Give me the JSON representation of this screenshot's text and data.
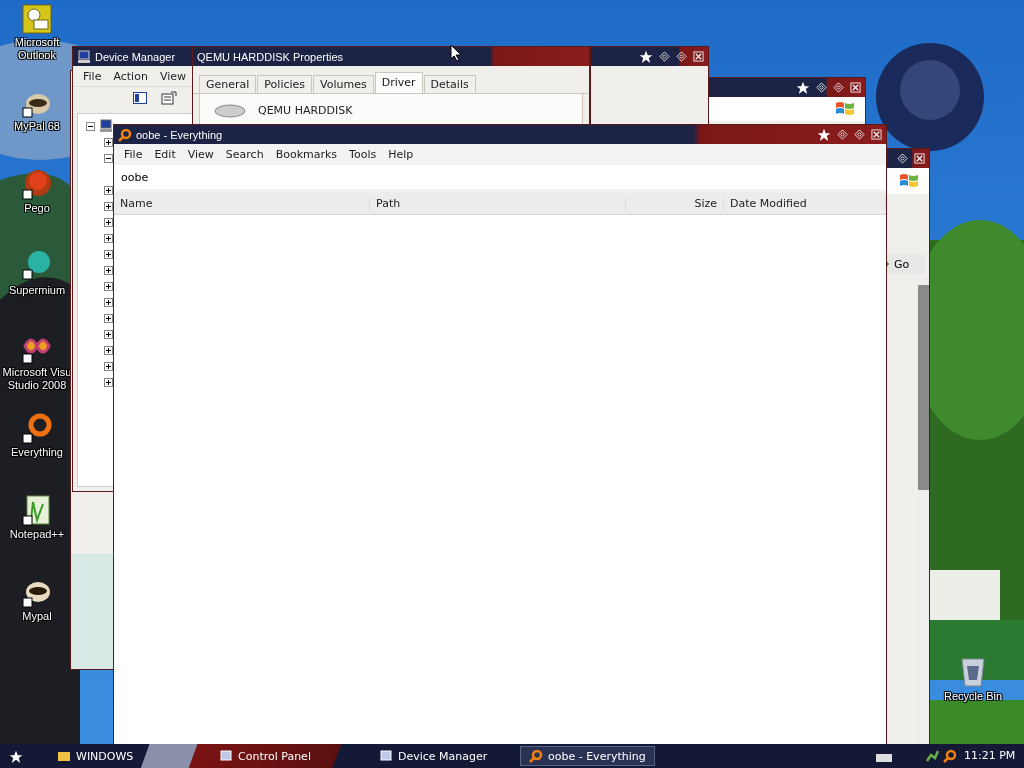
{
  "desktop_icons": [
    {
      "label": "Microsoft Outlook"
    },
    {
      "label": "MyPal 68"
    },
    {
      "label": "Pego"
    },
    {
      "label": "Supermium"
    },
    {
      "label": "Microsoft Visu Studio 2008"
    },
    {
      "label": "Everything"
    },
    {
      "label": "Notepad++"
    },
    {
      "label": "Mypal"
    },
    {
      "label": "Recycle Bin"
    }
  ],
  "device_manager": {
    "title": "Device Manager",
    "menu": [
      "File",
      "Action",
      "View"
    ],
    "tree": {
      "expanded": true,
      "children": [
        {
          "expanded": false
        },
        {
          "expanded": true
        },
        {
          "expanded": false
        },
        {
          "expanded": false
        },
        {
          "expanded": false
        },
        {
          "expanded": false
        },
        {
          "expanded": false
        },
        {
          "expanded": false
        },
        {
          "expanded": false
        },
        {
          "expanded": false
        },
        {
          "expanded": false
        },
        {
          "expanded": false
        },
        {
          "expanded": false
        },
        {
          "expanded": false
        },
        {
          "expanded": false
        }
      ]
    }
  },
  "properties": {
    "title": "QEMU HARDDISK Properties",
    "tabs": [
      {
        "label": "General",
        "selected": false
      },
      {
        "label": "Policies",
        "selected": false
      },
      {
        "label": "Volumes",
        "selected": false
      },
      {
        "label": "Driver",
        "selected": true
      },
      {
        "label": "Details",
        "selected": false
      }
    ],
    "device_name": "QEMU HARDDISK"
  },
  "right_window": {
    "go_button": "Go"
  },
  "everything": {
    "title": "oobe - Everything",
    "menu": [
      "File",
      "Edit",
      "View",
      "Search",
      "Bookmarks",
      "Tools",
      "Help"
    ],
    "search": {
      "value": "oobe"
    },
    "columns": [
      "Name",
      "Path",
      "Size",
      "Date Modified"
    ]
  },
  "taskbar": {
    "items": [
      {
        "label": "WINDOWS",
        "selected": false
      },
      {
        "label": "Control Panel",
        "selected": false
      },
      {
        "label": "Device Manager",
        "selected": false
      },
      {
        "label": "oobe - Everything",
        "selected": true
      }
    ],
    "clock": "11:21 PM"
  }
}
